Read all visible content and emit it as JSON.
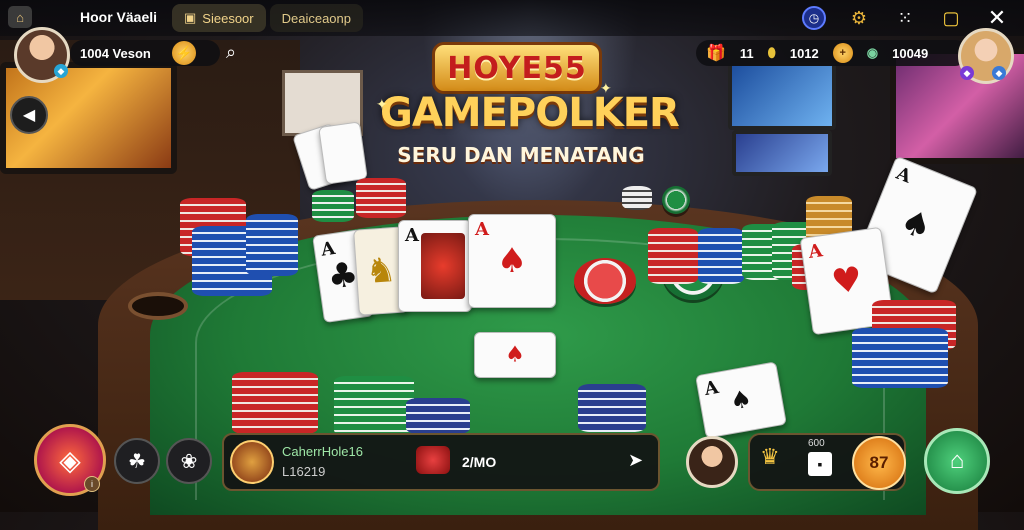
{
  "topbar": {
    "home_icon": "home-icon",
    "brand": "Hoor Väaeli",
    "tabs": [
      {
        "label": "Sieesoor",
        "icon": "briefcase-icon"
      },
      {
        "label": "Deaiceaonp"
      }
    ],
    "right_icons": [
      "clock-icon",
      "gear-icon",
      "grid-icon",
      "expand-icon",
      "close-icon"
    ]
  },
  "player_left": {
    "balance": "1004 Veson",
    "badge": "level-badge-icon",
    "action_icon": "lightning-icon",
    "search_icon": "search-icon"
  },
  "resources": [
    {
      "icon": "gift-box-icon",
      "value": "11"
    },
    {
      "icon": "potion-icon",
      "value": "1012"
    },
    {
      "icon": "coin-icon",
      "value": ""
    },
    {
      "icon": "gem-icon",
      "value": "10049"
    }
  ],
  "logo": {
    "brand": "HOYE55",
    "title": "GAMEPOLKER",
    "subtitle": "SERU DAN MENATANG"
  },
  "table_cards": [
    {
      "rank": "A",
      "suit": "♣",
      "color": "black"
    },
    {
      "rank": "",
      "suit": "♞",
      "color": "black"
    },
    {
      "rank": "A",
      "suit": "♣",
      "color": "black"
    },
    {
      "rank": "A",
      "suit": "♠",
      "color": "red"
    },
    {
      "rank": "",
      "suit": "♠",
      "color": "red"
    },
    {
      "rank": "A",
      "suit": "♠",
      "color": "black"
    },
    {
      "rank": "A",
      "suit": "♥",
      "color": "red"
    },
    {
      "rank": "A",
      "suit": "♠",
      "color": "black"
    }
  ],
  "bottom": {
    "main_button_icon": "diamond-icon",
    "small_buttons": [
      "pet-icon",
      "paw-icon"
    ],
    "info": {
      "name": "CaherrHole16",
      "amount": "L16219",
      "bet": "2/MO",
      "arrow": "arrow-icon"
    },
    "right_panel": {
      "label": "600",
      "value": "87"
    },
    "home_icon": "home-icon"
  },
  "colors": {
    "felt": "#1f7a36",
    "gold": "#ffd15a",
    "red_chip": "#d52b2b",
    "blue_chip": "#1f4fb0",
    "green_chip": "#1f8e43"
  }
}
